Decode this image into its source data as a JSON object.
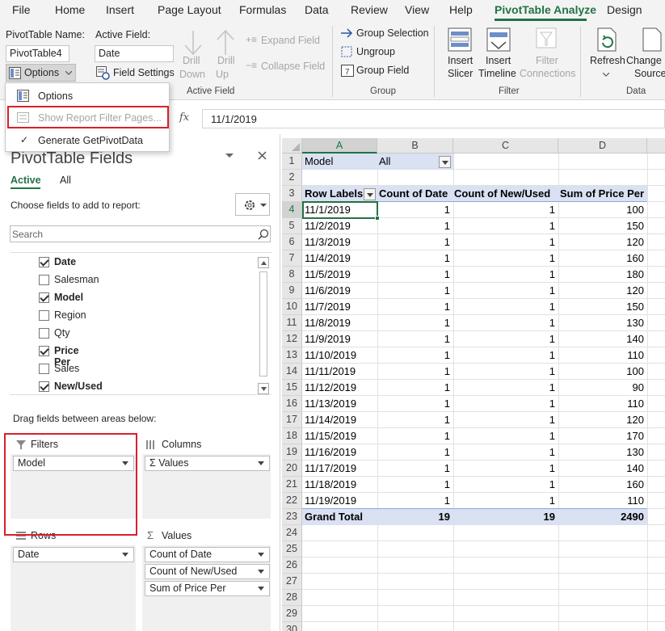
{
  "menu_tabs": [
    {
      "label": "File"
    },
    {
      "label": "Home"
    },
    {
      "label": "Insert"
    },
    {
      "label": "Page Layout"
    },
    {
      "label": "Formulas"
    },
    {
      "label": "Data"
    },
    {
      "label": "Review"
    },
    {
      "label": "View"
    },
    {
      "label": "Help"
    },
    {
      "label": "PivotTable Analyze"
    },
    {
      "label": "Design"
    }
  ],
  "ribbon": {
    "pivot_name_label": "PivotTable Name:",
    "pivot_name_value": "PivotTable4",
    "options_button": "Options",
    "active_field_label": "Active Field:",
    "active_field_value": "Date",
    "field_settings": "Field Settings",
    "drill_down": [
      "Drill",
      "Down"
    ],
    "drill_up": [
      "Drill",
      "Up"
    ],
    "expand_field": "Expand Field",
    "collapse_field": "Collapse Field",
    "active_field_group": "Active Field",
    "group_selection": "Group Selection",
    "ungroup": "Ungroup",
    "group_field": "Group Field",
    "group_group": "Group",
    "insert_slicer": [
      "Insert",
      "Slicer"
    ],
    "insert_timeline": [
      "Insert",
      "Timeline"
    ],
    "filter_connections": [
      "Filter",
      "Connections"
    ],
    "filter_group": "Filter",
    "refresh": "Refresh",
    "change_data_source": [
      "Change D",
      "Source"
    ],
    "data_group": "Data"
  },
  "options_menu": {
    "items": [
      {
        "label": "Options",
        "enabled": true
      },
      {
        "label": "Show Report Filter Pages...",
        "enabled": false
      },
      {
        "label": "Generate GetPivotData",
        "checked": true
      }
    ]
  },
  "formula_bar": {
    "fx": "fx",
    "value": "11/1/2019"
  },
  "pivot_pane": {
    "title": "PivotTable Fields",
    "tab_active": "Active",
    "tab_all": "All",
    "choose_label": "Choose fields to add to report:",
    "search_placeholder": "Search",
    "fields": [
      {
        "name": "Date",
        "checked": true
      },
      {
        "name": "Salesman",
        "checked": false
      },
      {
        "name": "Model",
        "checked": true
      },
      {
        "name": "Region",
        "checked": false
      },
      {
        "name": "Qty",
        "checked": false
      },
      {
        "name": "Price Per",
        "checked": true
      },
      {
        "name": "Sales",
        "checked": false
      },
      {
        "name": "New/Used",
        "checked": true
      }
    ],
    "drag_label": "Drag fields between areas below:",
    "filters_label": "Filters",
    "columns_label": "Columns",
    "rows_label": "Rows",
    "values_label": "Values",
    "filters_items": [
      "Model"
    ],
    "columns_items": [
      "Values"
    ],
    "rows_items": [
      "Date"
    ],
    "values_items": [
      "Count of Date",
      "Count of New/Used",
      "Sum of Price Per"
    ]
  },
  "sheet": {
    "columns": [
      "A",
      "B",
      "C",
      "D"
    ],
    "filter_row": {
      "label": "Model",
      "value": "All"
    },
    "headers": [
      "Row Labels",
      "Count of Date",
      "Count of New/Used",
      "Sum of Price Per"
    ],
    "rows": [
      [
        "11/1/2019",
        "1",
        "1",
        "100"
      ],
      [
        "11/2/2019",
        "1",
        "1",
        "150"
      ],
      [
        "11/3/2019",
        "1",
        "1",
        "120"
      ],
      [
        "11/4/2019",
        "1",
        "1",
        "160"
      ],
      [
        "11/5/2019",
        "1",
        "1",
        "180"
      ],
      [
        "11/6/2019",
        "1",
        "1",
        "120"
      ],
      [
        "11/7/2019",
        "1",
        "1",
        "150"
      ],
      [
        "11/8/2019",
        "1",
        "1",
        "130"
      ],
      [
        "11/9/2019",
        "1",
        "1",
        "140"
      ],
      [
        "11/10/2019",
        "1",
        "1",
        "110"
      ],
      [
        "11/11/2019",
        "1",
        "1",
        "100"
      ],
      [
        "11/12/2019",
        "1",
        "1",
        "90"
      ],
      [
        "11/13/2019",
        "1",
        "1",
        "110"
      ],
      [
        "11/14/2019",
        "1",
        "1",
        "120"
      ],
      [
        "11/15/2019",
        "1",
        "1",
        "170"
      ],
      [
        "11/16/2019",
        "1",
        "1",
        "130"
      ],
      [
        "11/17/2019",
        "1",
        "1",
        "140"
      ],
      [
        "11/18/2019",
        "1",
        "1",
        "160"
      ],
      [
        "11/19/2019",
        "1",
        "1",
        "110"
      ]
    ],
    "grand_total": [
      "Grand Total",
      "19",
      "19",
      "2490"
    ],
    "row_numbers": [
      "1",
      "2",
      "3",
      "4",
      "5",
      "6",
      "7",
      "8",
      "9",
      "10",
      "11",
      "12",
      "13",
      "14",
      "15",
      "16",
      "17",
      "18",
      "19",
      "20",
      "21",
      "22",
      "23",
      "24",
      "25",
      "26",
      "27",
      "28",
      "29",
      "30"
    ]
  },
  "colors": {
    "accent": "#217346",
    "highlight_box": "#d9202a",
    "header_fill": "#d9e1f2"
  }
}
